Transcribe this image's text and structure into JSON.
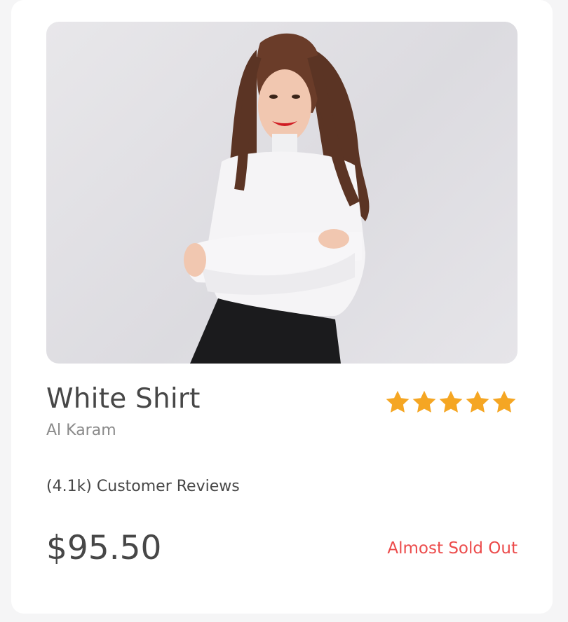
{
  "product": {
    "title": "White Shirt",
    "brand": "Al Karam",
    "image_alt": "woman-in-white-turtleneck-photo",
    "rating": {
      "value": 5,
      "max": 5,
      "color": "#f5a623"
    },
    "reviews_text": "(4.1k) Customer Reviews",
    "price": "$95.50",
    "stock_status": "Almost Sold Out",
    "stock_color": "#ec4b4b"
  }
}
